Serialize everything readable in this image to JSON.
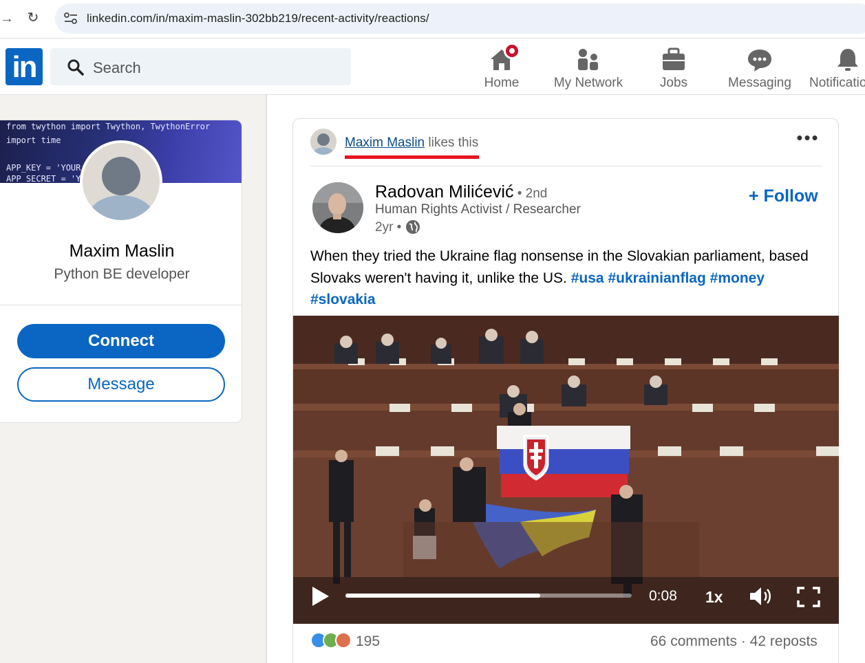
{
  "browser": {
    "url": "linkedin.com/in/maxim-maslin-302bb219/recent-activity/reactions/"
  },
  "header": {
    "logo": "in",
    "search_placeholder": "Search",
    "nav": [
      {
        "label": "Home",
        "icon": "home-icon",
        "has_badge": true
      },
      {
        "label": "My Network",
        "icon": "my-network-icon"
      },
      {
        "label": "Jobs",
        "icon": "jobs-icon"
      },
      {
        "label": "Messaging",
        "icon": "messaging-icon"
      },
      {
        "label": "Notifications",
        "icon": "notifications-icon"
      }
    ]
  },
  "profile": {
    "banner_code": [
      "from twython import Twython, TwythonError",
      "import time",
      "APP_KEY = 'YOUR K",
      "APP_SECRET = 'YOU"
    ],
    "name": "Maxim Maslin",
    "headline": "Python BE developer",
    "connect_label": "Connect",
    "message_label": "Message"
  },
  "post": {
    "reactor_name": "Maxim Maslin",
    "reactor_action": " likes this",
    "author": {
      "name": "Radovan Milićević",
      "degree": " • 2nd",
      "headline": "Human Rights Activist / Researcher",
      "time": "2yr •"
    },
    "follow_label": "+ Follow",
    "text": "When they tried the Ukraine flag nonsense in the Slovakian parliament, based Slovaks weren't having it, unlike the US.",
    "hashtags": [
      "#usa",
      "#ukrainianflag",
      "#money",
      "#slovakia"
    ],
    "video": {
      "time": "0:08",
      "speed": "1x",
      "progress_fraction": 0.68
    },
    "reaction_count": "195",
    "comments": "66 comments",
    "separator": " · ",
    "reposts": "42 reposts",
    "colors": {
      "accent": "#0a66c2",
      "reaction_like": "#378fe9",
      "reaction_support": "#6dae4f",
      "reaction_love": "#df704d"
    }
  }
}
